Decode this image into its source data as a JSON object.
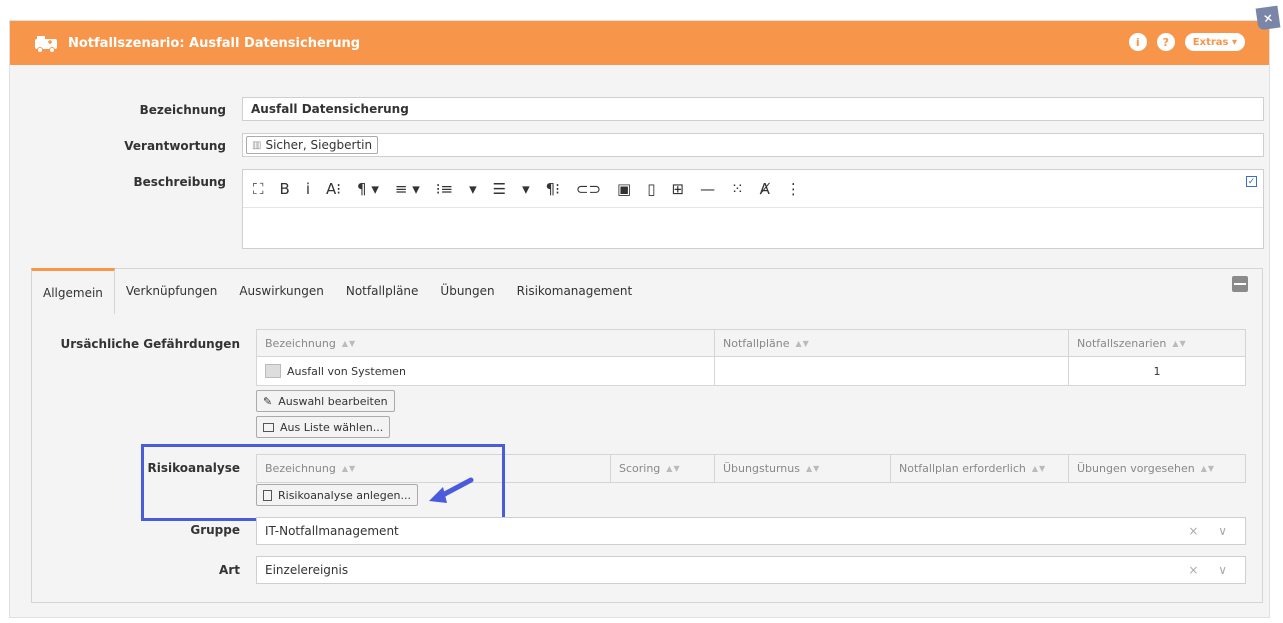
{
  "window": {
    "title": "Notfallszenario: Ausfall Datensicherung",
    "extras_label": "Extras",
    "info_glyph": "i",
    "help_glyph": "?",
    "close_glyph": "×"
  },
  "form": {
    "bezeichnung_label": "Bezeichnung",
    "bezeichnung_value": "Ausfall Datensicherung",
    "verantwortung_label": "Verantwortung",
    "verantwortung_value": "Sicher, Siegbertin",
    "beschreibung_label": "Beschreibung",
    "editor_tools": [
      "⛶",
      "B",
      "i",
      "A⁝",
      "¶ ▾",
      "≡ ▾",
      "⁝≡",
      "▾",
      "☰",
      "▾",
      "¶⁝",
      "⊂⊃",
      "▣",
      "▯",
      "⊞",
      "—",
      "⁙",
      "Ⱥ",
      "⋮"
    ]
  },
  "tabs": [
    "Allgemein",
    "Verknüpfungen",
    "Auswirkungen",
    "Notfallpläne",
    "Übungen",
    "Risikomanagement"
  ],
  "gefaehrdungen": {
    "label": "Ursächliche Gefährdungen",
    "columns": [
      "Bezeichnung",
      "Notfallpläne",
      "Notfallszenarien"
    ],
    "rows": [
      {
        "bezeichnung": "Ausfall von Systemen",
        "notfallplaene": "",
        "notfallszenarien": "1"
      }
    ],
    "btn_edit": "Auswahl bearbeiten",
    "btn_list": "Aus Liste wählen..."
  },
  "risikoanalyse": {
    "label": "Risikoanalyse",
    "columns": [
      "Bezeichnung",
      "Scoring",
      "Übungsturnus",
      "Notfallplan erforderlich",
      "Übungen vorgesehen"
    ],
    "btn_create": "Risikoanalyse anlegen..."
  },
  "gruppe": {
    "label": "Gruppe",
    "value": "IT-Notfallmanagement"
  },
  "art": {
    "label": "Art",
    "value": "Einzelereignis"
  },
  "sort_glyph": "▲▼",
  "select_controls": "× ∨",
  "colors": {
    "accent": "#f7964a",
    "highlight": "#4a5bdb"
  }
}
